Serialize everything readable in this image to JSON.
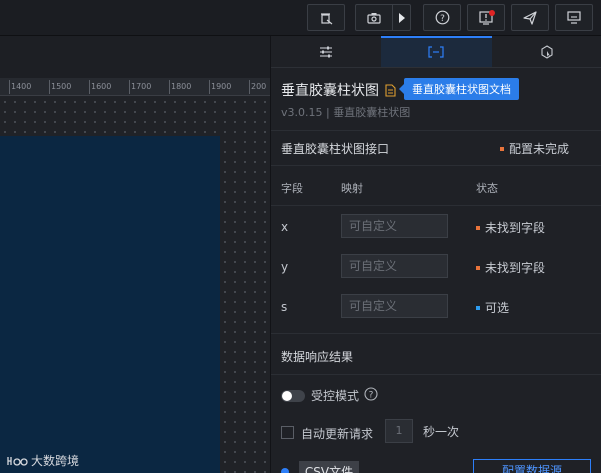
{
  "toolbar": {
    "buttons": [
      {
        "name": "clear-icon"
      },
      {
        "name": "camera-icon"
      },
      {
        "name": "help-icon"
      },
      {
        "name": "notification-icon"
      },
      {
        "name": "send-icon"
      },
      {
        "name": "monitor-icon"
      }
    ],
    "badge_color": "#e02424"
  },
  "ruler": {
    "ticks": [
      "1400",
      "1500",
      "1600",
      "1700",
      "1800",
      "1900",
      "200"
    ]
  },
  "brand": {
    "logo_text": "大数跨境"
  },
  "panel": {
    "tabs": [
      {
        "icon": "sliders-icon"
      },
      {
        "icon": "data-bracket-icon",
        "active": true
      },
      {
        "icon": "interaction-icon"
      }
    ],
    "component_title": "垂直胶囊柱状图",
    "doc_tooltip": "垂直胶囊柱状图文档",
    "version": "v3.0.15 | 垂直胶囊柱状图",
    "interface": {
      "title": "垂直胶囊柱状图接口",
      "status": "配置未完成",
      "status_color": "#e8743b"
    },
    "table": {
      "headers": {
        "field": "字段",
        "mapping": "映射",
        "status": "状态"
      },
      "rows": [
        {
          "field": "x",
          "placeholder": "可自定义",
          "status": "未找到字段",
          "color": "#e8743b"
        },
        {
          "field": "y",
          "placeholder": "可自定义",
          "status": "未找到字段",
          "color": "#e8743b"
        },
        {
          "field": "s",
          "placeholder": "可自定义",
          "status": "可选",
          "color": "#2d9cf0"
        }
      ]
    },
    "response": {
      "title": "数据响应结果",
      "controlled_mode": "受控模式",
      "auto_update": "自动更新请求",
      "interval_value": "1",
      "interval_unit": "秒一次"
    },
    "source": {
      "csv_label": "CSV文件",
      "config_button": "配置数据源"
    }
  }
}
